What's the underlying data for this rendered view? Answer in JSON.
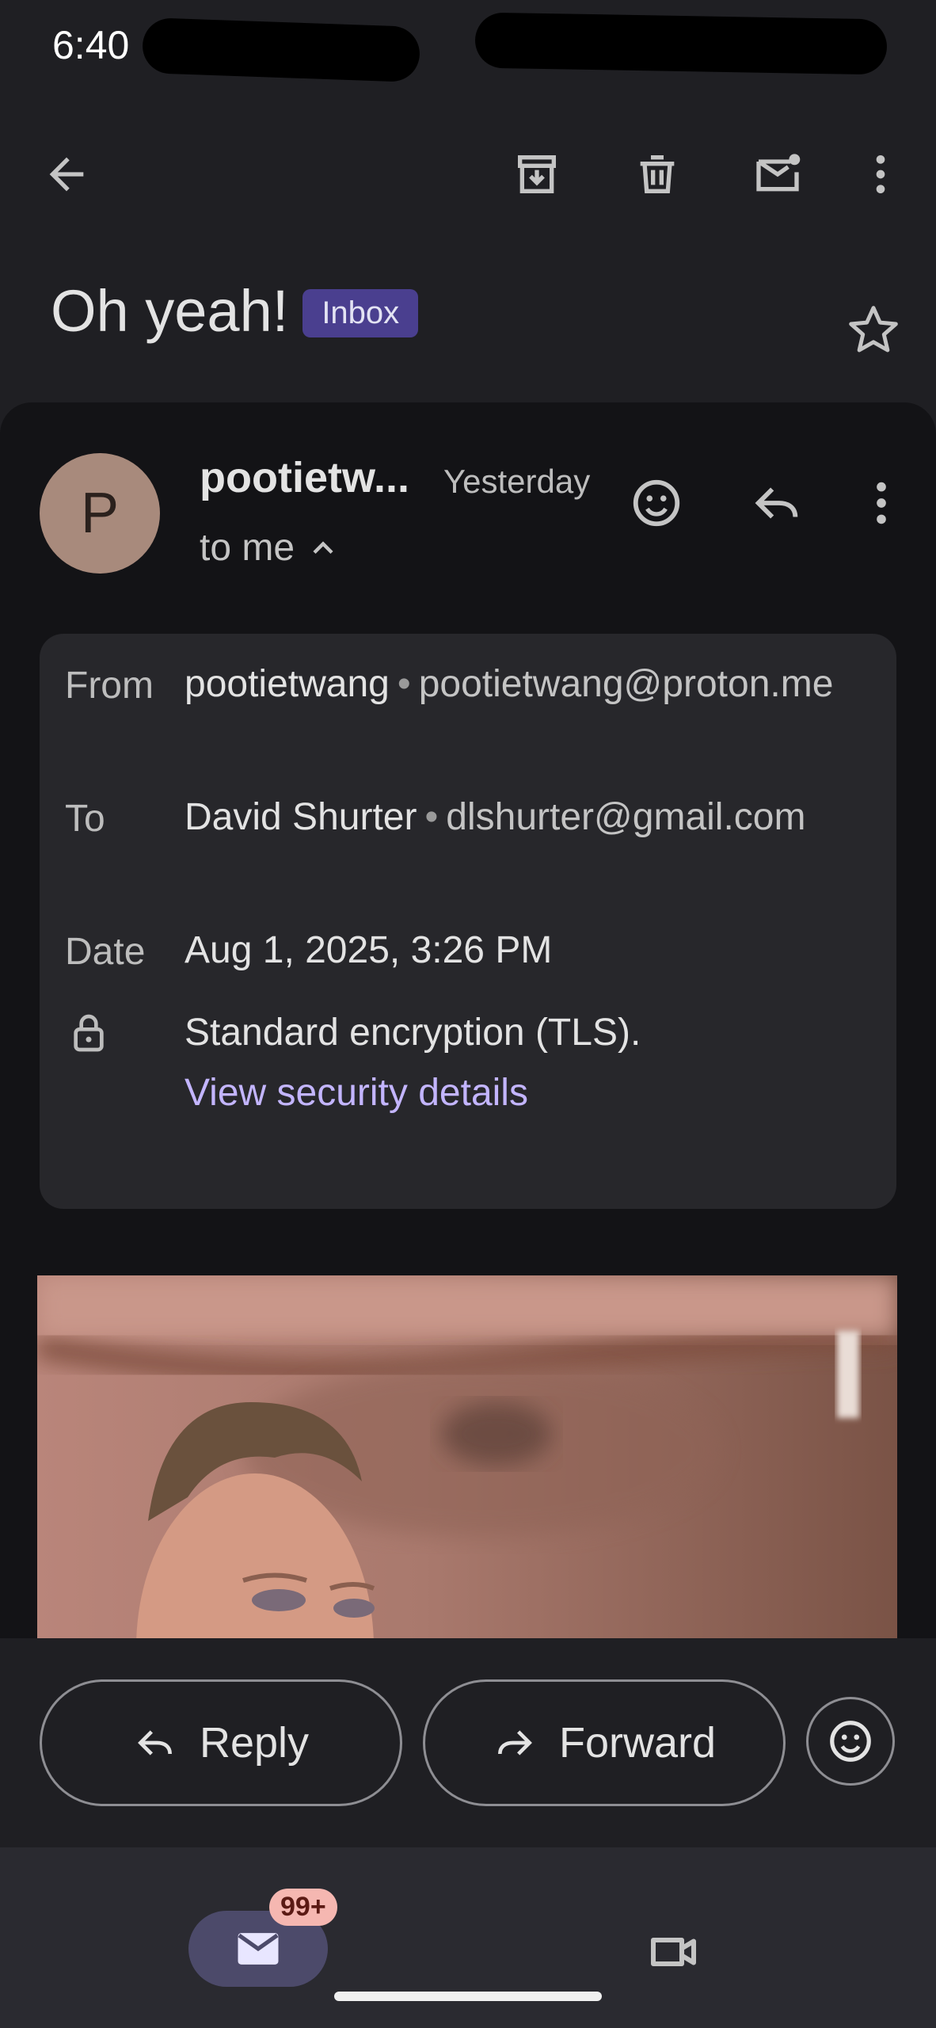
{
  "status_bar": {
    "time": "6:40"
  },
  "toolbar": {
    "back_icon": "arrow-back-icon",
    "archive_icon": "archive-icon",
    "delete_icon": "trash-icon",
    "mark_unread_icon": "mail-unread-icon",
    "more_icon": "more-vert-icon"
  },
  "subject": {
    "title": "Oh yeah!",
    "label": "Inbox"
  },
  "message": {
    "avatar_letter": "P",
    "sender_short": "pootietw...",
    "time": "Yesterday",
    "recipient_summary": "to me"
  },
  "details": {
    "from_label": "From",
    "from_name": "pootietwang",
    "from_email": "pootietwang@proton.me",
    "to_label": "To",
    "to_name": "David Shurter",
    "to_email": "dlshurter@gmail.com",
    "date_label": "Date",
    "date_value": "Aug 1, 2025, 3:26 PM",
    "encryption_text": "Standard encryption (TLS).",
    "security_link": "View security details"
  },
  "actions": {
    "reply": "Reply",
    "forward": "Forward"
  },
  "nav": {
    "mail_badge": "99+"
  },
  "colors": {
    "background": "#1f1f23",
    "card": "#131316",
    "label_chip": "#4a3f8f",
    "link": "#c3b5ff",
    "badge": "#f5b7b1"
  }
}
